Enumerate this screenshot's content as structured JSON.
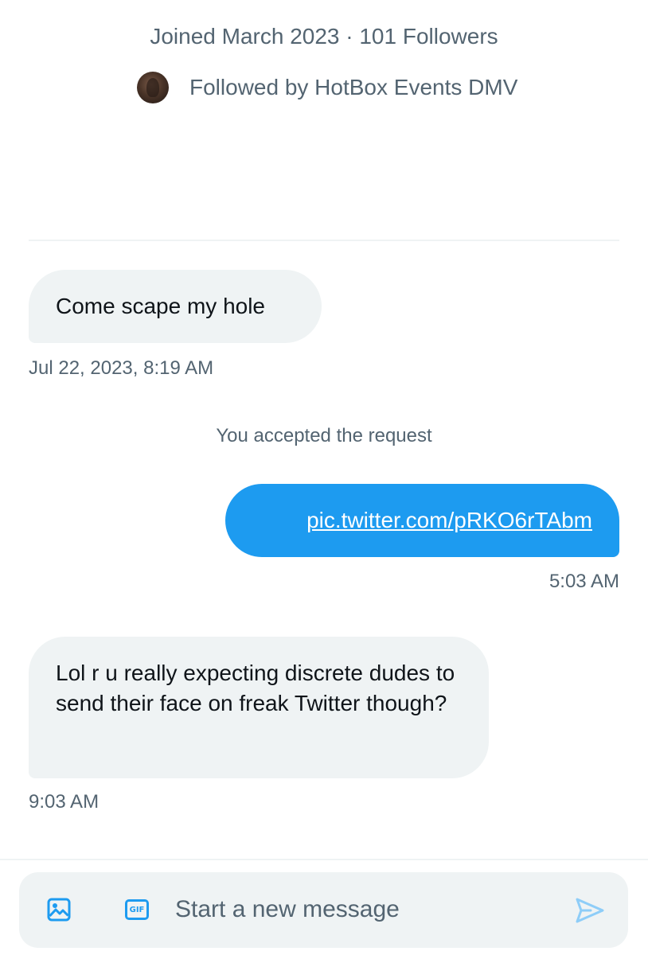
{
  "profile": {
    "joined_line": "Joined March 2023 · 101 Followers",
    "followed_by": "Followed by HotBox Events DMV"
  },
  "conversation": {
    "messages": [
      {
        "direction": "received",
        "text": "Come scape my hole",
        "timestamp": "Jul 22, 2023, 8:19 AM"
      },
      {
        "direction": "sent",
        "text": "pic.twitter.com/pRKO6rTAbm",
        "timestamp": "5:03 AM"
      },
      {
        "direction": "received",
        "text": "Lol r u really expecting discrete dudes to send their face on freak Twitter though?",
        "timestamp": "9:03 AM"
      }
    ],
    "system_note": "You accepted the request"
  },
  "composer": {
    "placeholder": "Start a new message",
    "media_icon": "image-icon",
    "gif_icon": "gif-icon",
    "gif_label": "GIF",
    "send_icon": "send-icon"
  },
  "colors": {
    "accent": "#1d9bf0",
    "received_bubble": "#eff3f4",
    "secondary_text": "#536471",
    "primary_text": "#0f1419"
  }
}
